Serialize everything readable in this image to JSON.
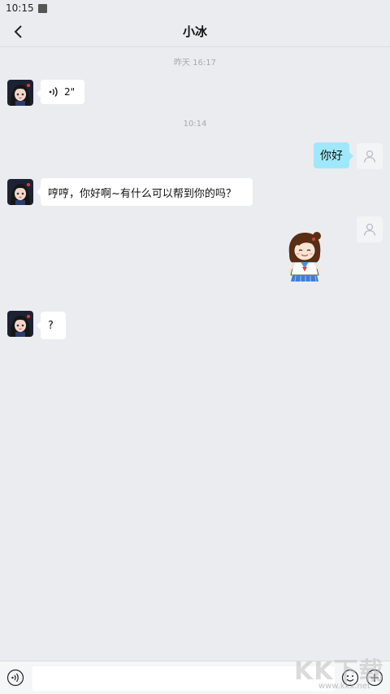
{
  "status_bar": {
    "time": "10:15"
  },
  "header": {
    "title": "小冰"
  },
  "messages": {
    "ts1": "昨天 16:17",
    "voice_duration": "2\"",
    "ts2": "10:14",
    "me_text": "你好",
    "bot_reply": "哼哼，你好啊~有什么可以帮到你的吗？",
    "bot_question": "?"
  },
  "input_bar": {
    "placeholder": ""
  },
  "watermark": {
    "logo": "KK下载",
    "url": "www.kkx.net"
  },
  "colors": {
    "background": "#ebecef",
    "my_bubble": "#9fe8fb",
    "bot_bubble": "#ffffff"
  }
}
